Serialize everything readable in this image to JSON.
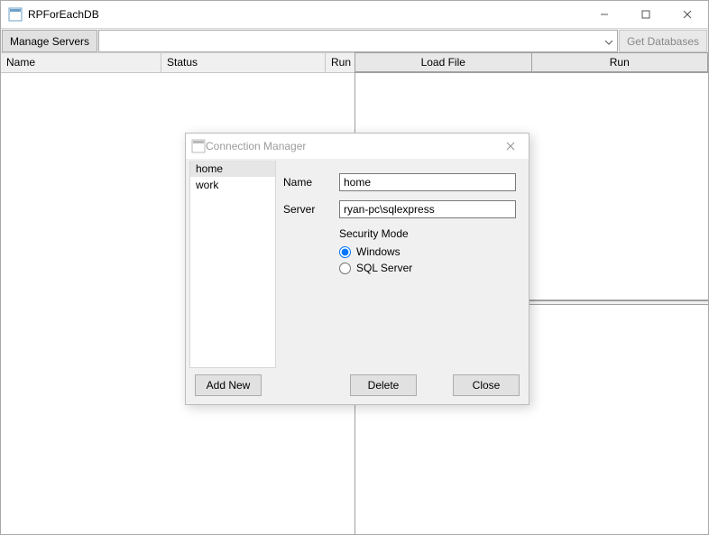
{
  "window": {
    "title": "RPForEachDB",
    "toolbar": {
      "manageServers": "Manage Servers",
      "getDatabases": "Get Databases"
    },
    "columns": {
      "name": "Name",
      "status": "Status",
      "run": "Run"
    },
    "tabs": {
      "loadFile": "Load File",
      "run": "Run"
    }
  },
  "dialog": {
    "title": "Connection Manager",
    "list": [
      "home",
      "work"
    ],
    "selected": "home",
    "form": {
      "nameLabel": "Name",
      "nameValue": "home",
      "serverLabel": "Server",
      "serverValue": "ryan-pc\\sqlexpress",
      "securityTitle": "Security Mode",
      "radioWindows": "Windows",
      "radioSql": "SQL Server"
    },
    "buttons": {
      "add": "Add New",
      "delete": "Delete",
      "close": "Close"
    }
  }
}
